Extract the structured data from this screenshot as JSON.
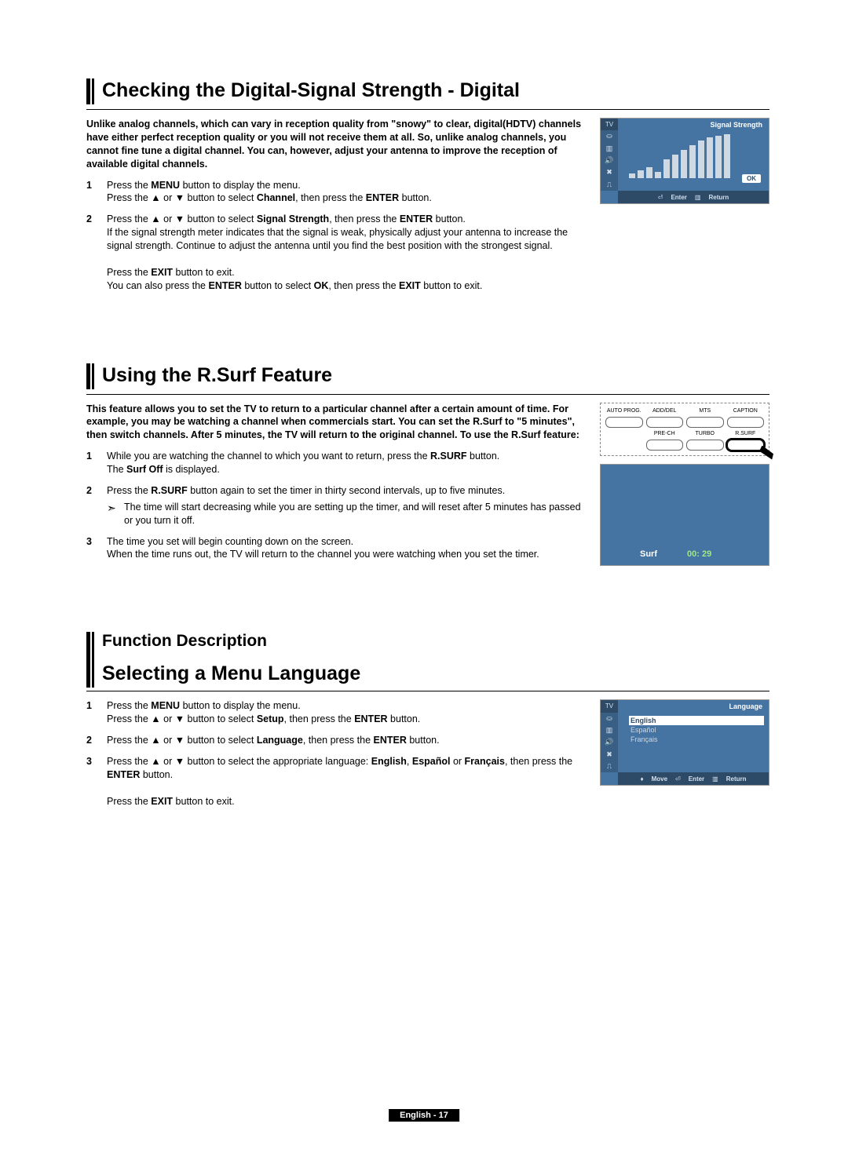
{
  "sections": {
    "s1": {
      "title": "Checking the Digital-Signal Strength - Digital",
      "intro": "Unlike analog channels, which can vary in reception quality from \"snowy\" to clear, digital(HDTV) channels have either perfect reception quality or you will not receive them at all. So, unlike analog channels, you cannot fine tune a digital channel. You can, however, adjust your antenna to improve the reception of available digital channels.",
      "steps": {
        "1a": "Press the ",
        "1b": "MENU",
        "1c": " button to display the menu.",
        "1d": "Press the ▲ or ▼ button to select ",
        "1e": "Channel",
        "1f": ", then press the ",
        "1g": "ENTER",
        "1h": " button.",
        "2a": "Press the ▲ or ▼ button to select ",
        "2b": "Signal Strength",
        "2c": ", then press the ",
        "2d": "ENTER",
        "2e": " button.",
        "2f": "If the signal strength meter indicates that the signal is weak, physically adjust your antenna to increase the signal strength. Continue to adjust the antenna until you find the best position with the strongest signal.",
        "2g": "Press the ",
        "2h": "EXIT",
        "2i": " button to exit.",
        "2j": "You can also press the ",
        "2k": "ENTER",
        "2l": " button to select ",
        "2m": "OK",
        "2n": ", then press the ",
        "2o": "EXIT",
        "2p": " button to exit."
      }
    },
    "s2": {
      "title": "Using the R.Surf Feature",
      "intro": "This feature allows you to set the TV to return to a particular channel after a certain amount of time. For example, you may be watching a channel when commercials start. You can set the R.Surf to \"5 minutes\", then switch channels. After 5 minutes, the TV will return to the original channel. To use the R.Surf feature:",
      "steps": {
        "1a": "While you are watching the channel to which you want to return, press the ",
        "1b": "R.SURF",
        "1c": " button.",
        "1d": "The ",
        "1e": "Surf Off",
        "1f": " is displayed.",
        "2a": "Press the ",
        "2b": "R.SURF",
        "2c": " button again to set the timer in thirty second intervals, up to five minutes.",
        "2d": "The time will start decreasing while you are setting up the timer, and will reset after 5 minutes has passed or you turn it off.",
        "3a": "The time you set will begin counting down on the screen.",
        "3b": "When the time runs out, the TV will return to the channel you were watching when you set the timer."
      }
    },
    "s3": {
      "label": "Function Description",
      "title": "Selecting a Menu Language",
      "steps": {
        "1a": "Press the ",
        "1b": "MENU",
        "1c": " button to display the menu.",
        "1d": "Press the ▲ or ▼ button to select ",
        "1e": "Setup",
        "1f": ", then press the ",
        "1g": "ENTER",
        "1h": " button.",
        "2a": "Press the ▲ or ▼ button to select ",
        "2b": "Language",
        "2c": ", then press the ",
        "2d": "ENTER",
        "2e": " button.",
        "3a": "Press the ▲ or ▼ button to select the appropriate language: ",
        "3b": "English",
        "3c": ", ",
        "3d": "Español",
        "3e": " or ",
        "3f": "Français",
        "3g": ", then press the ",
        "3h": "ENTER",
        "3i": " button.",
        "3j": "Press the ",
        "3k": "EXIT",
        "3l": " button to exit."
      }
    }
  },
  "osd": {
    "signal": {
      "tv": "TV",
      "header": "Signal Strength",
      "ok": "OK",
      "enter": "Enter",
      "return": "Return"
    },
    "remote": {
      "btns": [
        "AUTO PROG.",
        "ADD/DEL",
        "MTS",
        "CAPTION",
        "PRE-CH",
        "TURBO",
        "R.SURF"
      ]
    },
    "surf": {
      "label": "Surf",
      "time": "00: 29"
    },
    "lang": {
      "tv": "TV",
      "header": "Language",
      "items": [
        "English",
        "Español",
        "Français"
      ],
      "move": "Move",
      "enter": "Enter",
      "return": "Return"
    }
  },
  "footer": "English - 17",
  "chart_data": {
    "type": "bar",
    "title": "Signal Strength",
    "categories": [
      "b1",
      "b2",
      "b3",
      "b4",
      "b5",
      "b6",
      "b7",
      "b8",
      "b9",
      "b10",
      "b11",
      "b12"
    ],
    "values": [
      6,
      10,
      14,
      8,
      24,
      30,
      36,
      42,
      48,
      52,
      54,
      56
    ],
    "ylim": [
      0,
      58
    ]
  }
}
